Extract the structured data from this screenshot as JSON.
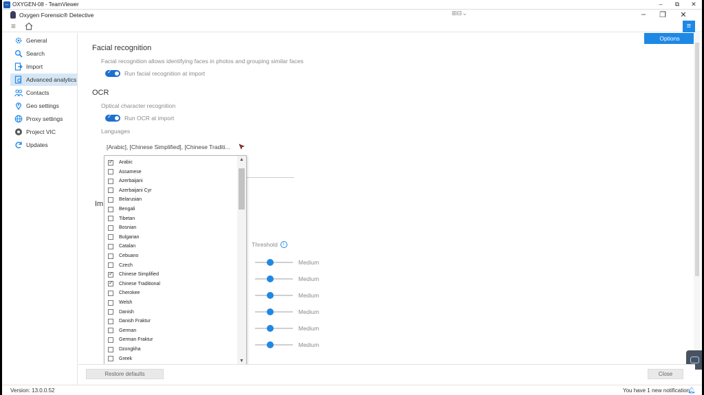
{
  "teamviewer": {
    "title": "OXYGEN-08 - TeamViewer",
    "minimize": "–",
    "restore": "⧉",
    "close": "✕",
    "center_controls": "⊞⊟⌄"
  },
  "app": {
    "title": "Oxygen Forensic® Detective",
    "minimize": "–",
    "restore": "❐",
    "close": "✕"
  },
  "toolbar": {
    "menu_icon": "hamburger-icon",
    "home_icon": "home-icon",
    "filter_icon": "filter-icon"
  },
  "options_tab": "Options",
  "sidebar": {
    "items": [
      {
        "label": "General",
        "icon": "gear-icon",
        "active": false
      },
      {
        "label": "Search",
        "icon": "search-icon",
        "active": false
      },
      {
        "label": "Import",
        "icon": "import-icon",
        "active": false
      },
      {
        "label": "Advanced analytics",
        "icon": "analytics-icon",
        "active": true
      },
      {
        "label": "Contacts",
        "icon": "contacts-icon",
        "active": false
      },
      {
        "label": "Geo settings",
        "icon": "geo-icon",
        "active": false
      },
      {
        "label": "Proxy settings",
        "icon": "globe-icon",
        "active": false
      },
      {
        "label": "Project VIC",
        "icon": "vic-icon",
        "active": false
      },
      {
        "label": "Updates",
        "icon": "refresh-icon",
        "active": false
      }
    ]
  },
  "facial": {
    "title": "Facial recognition",
    "description": "Facial recognition allows identifying faces in photos and grouping similar faces",
    "toggle_label": "Run facial recognition at import",
    "toggle_on": true
  },
  "ocr": {
    "title": "OCR",
    "description": "Optical character recognition",
    "toggle_label": "Run OCR at import",
    "toggle_on": true,
    "languages_label": "Languages",
    "languages_value": "[Arabic], [Chinese Simplified], [Chinese Traditi...",
    "languages": [
      {
        "name": "Arabic",
        "checked": true
      },
      {
        "name": "Assamese",
        "checked": false
      },
      {
        "name": "Azerbaijani",
        "checked": false
      },
      {
        "name": "Azerbaijani Cyr",
        "checked": false
      },
      {
        "name": "Belarusian",
        "checked": false
      },
      {
        "name": "Bengali",
        "checked": false
      },
      {
        "name": "Tibetan",
        "checked": false
      },
      {
        "name": "Bosnian",
        "checked": false
      },
      {
        "name": "Bulgarian",
        "checked": false
      },
      {
        "name": "Catalan",
        "checked": false
      },
      {
        "name": "Cebuano",
        "checked": false
      },
      {
        "name": "Czech",
        "checked": false
      },
      {
        "name": "Chinese Simplified",
        "checked": true
      },
      {
        "name": "Chinese Traditional",
        "checked": true
      },
      {
        "name": "Cherokee",
        "checked": false
      },
      {
        "name": "Welsh",
        "checked": false
      },
      {
        "name": "Danish",
        "checked": false
      },
      {
        "name": "Danish Fraktur",
        "checked": false
      },
      {
        "name": "German",
        "checked": false
      },
      {
        "name": "German Fraktur",
        "checked": false
      },
      {
        "name": "Dzongkha",
        "checked": false
      },
      {
        "name": "Greek",
        "checked": false
      }
    ]
  },
  "image_section": {
    "title_partial": "Im",
    "threshold_label": "Threshold",
    "sliders": [
      {
        "value": "Medium"
      },
      {
        "value": "Medium"
      },
      {
        "value": "Medium"
      },
      {
        "value": "Medium"
      },
      {
        "value": "Medium"
      },
      {
        "value": "Medium"
      }
    ]
  },
  "buttons": {
    "restore_defaults": "Restore defaults",
    "close": "Close"
  },
  "status": {
    "version": "Version: 13.0.0.52",
    "notification": "You have 1 new notification"
  },
  "colors": {
    "accent": "#1e88e5",
    "sidebar_active": "#d6e6f5"
  }
}
